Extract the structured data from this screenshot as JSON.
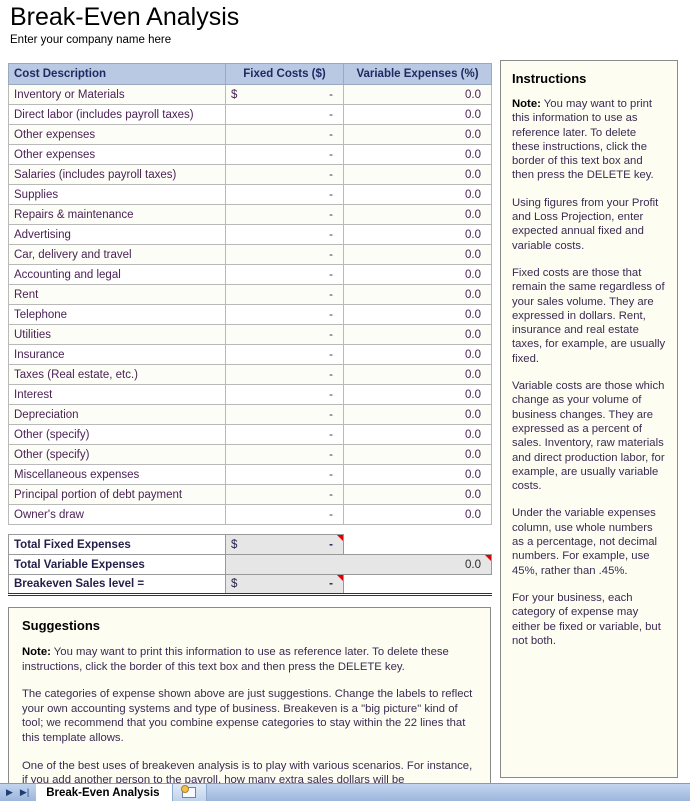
{
  "header": {
    "title": "Break-Even Analysis",
    "company_placeholder": "Enter your company name here"
  },
  "table": {
    "columns": [
      "Cost Description",
      "Fixed Costs ($)",
      "Variable Expenses (%)"
    ],
    "currency_symbol": "$",
    "dash": "-",
    "rows": [
      {
        "description": "Inventory or Materials",
        "fixed": "-",
        "currency": "$",
        "variable": "0.0"
      },
      {
        "description": "Direct labor (includes payroll taxes)",
        "fixed": "-",
        "currency": "",
        "variable": "0.0"
      },
      {
        "description": "Other expenses",
        "fixed": "-",
        "currency": "",
        "variable": "0.0"
      },
      {
        "description": "Other expenses",
        "fixed": "-",
        "currency": "",
        "variable": "0.0"
      },
      {
        "description": "Salaries (includes payroll taxes)",
        "fixed": "-",
        "currency": "",
        "variable": "0.0"
      },
      {
        "description": "Supplies",
        "fixed": "-",
        "currency": "",
        "variable": "0.0"
      },
      {
        "description": "Repairs & maintenance",
        "fixed": "-",
        "currency": "",
        "variable": "0.0"
      },
      {
        "description": "Advertising",
        "fixed": "-",
        "currency": "",
        "variable": "0.0"
      },
      {
        "description": "Car, delivery and travel",
        "fixed": "-",
        "currency": "",
        "variable": "0.0"
      },
      {
        "description": "Accounting and legal",
        "fixed": "-",
        "currency": "",
        "variable": "0.0"
      },
      {
        "description": "Rent",
        "fixed": "-",
        "currency": "",
        "variable": "0.0"
      },
      {
        "description": "Telephone",
        "fixed": "-",
        "currency": "",
        "variable": "0.0"
      },
      {
        "description": "Utilities",
        "fixed": "-",
        "currency": "",
        "variable": "0.0"
      },
      {
        "description": "Insurance",
        "fixed": "-",
        "currency": "",
        "variable": "0.0"
      },
      {
        "description": "Taxes (Real estate, etc.)",
        "fixed": "-",
        "currency": "",
        "variable": "0.0"
      },
      {
        "description": "Interest",
        "fixed": "-",
        "currency": "",
        "variable": "0.0"
      },
      {
        "description": "Depreciation",
        "fixed": "-",
        "currency": "",
        "variable": "0.0"
      },
      {
        "description": "Other (specify)",
        "fixed": "-",
        "currency": "",
        "variable": "0.0"
      },
      {
        "description": "Other (specify)",
        "fixed": "-",
        "currency": "",
        "variable": "0.0"
      },
      {
        "description": "Miscellaneous expenses",
        "fixed": "-",
        "currency": "",
        "variable": "0.0"
      },
      {
        "description": "Principal portion of debt payment",
        "fixed": "-",
        "currency": "",
        "variable": "0.0"
      },
      {
        "description": "Owner's draw",
        "fixed": "-",
        "currency": "",
        "variable": "0.0"
      }
    ]
  },
  "totals": {
    "fixed_label": "Total Fixed Expenses",
    "fixed_currency": "$",
    "fixed_value": "-",
    "variable_label": "Total Variable Expenses",
    "variable_value": "0.0",
    "breakeven_label": "Breakeven Sales level   =",
    "breakeven_currency": "$",
    "breakeven_value": "-"
  },
  "instructions": {
    "title": "Instructions",
    "note_label": "Note:",
    "note_text": " You may want to print this information to use as reference later.  To delete these instructions, click the border of this text box and then press the DELETE key.",
    "paragraphs": [
      "Using figures from your Profit and Loss Projection, enter expected annual fixed and variable costs.",
      "Fixed costs are those that remain the same regardless of your sales volume. They are expressed in dollars. Rent, insurance and real estate taxes, for example, are usually fixed.",
      "Variable costs are those which change as your volume of business changes. They are expressed as a percent of sales. Inventory, raw materials and direct production labor, for example, are usually variable costs.",
      "Under the variable expenses column, use whole numbers as a percentage, not decimal numbers. For example, use 45%, rather than .45%.",
      "For your business, each category of expense may either be fixed or variable, but not both."
    ]
  },
  "suggestions": {
    "title": "Suggestions",
    "note_label": "Note:",
    "note_text": " You may want to print this information to use as reference later. To delete these instructions, click the border of this text box and then press the DELETE key.",
    "paragraphs": [
      "The categories of expense shown above are just suggestions. Change the labels to reflect your own accounting systems and type of business. Breakeven is a \"big picture\" kind of tool; we recommend that you combine expense categories to stay within the 22 lines that this template allows.",
      "One of the best uses of breakeven analysis is to play with various scenarios. For instance, if you add another person to the payroll, how many extra sales dollars will be"
    ]
  },
  "tabbar": {
    "active_sheet": "Break-Even Analysis",
    "nav_prev": "◀",
    "nav_first": "▶",
    "nav_next": "▶",
    "nav_last": "▶|"
  },
  "colors": {
    "header_fill": "#b9c9e3",
    "text_purple": "#4b2355",
    "comment_marker": "#e00000",
    "panel_fill": "#fdfdf2",
    "tab_bar": "#9db6dc"
  }
}
